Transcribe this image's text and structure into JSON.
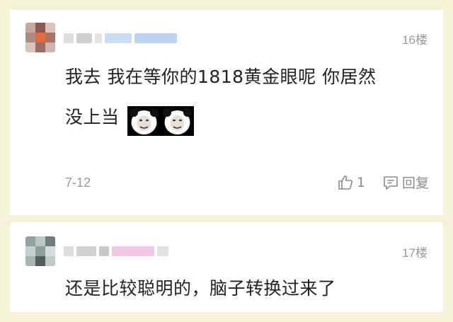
{
  "comments": [
    {
      "floor": "16楼",
      "text_line1": "我去 我在等你的1818黄金眼呢 你居然",
      "text_line2": "没上当",
      "stickers": [
        "panda-meme-sticker",
        "panda-meme-sticker"
      ],
      "date": "7-12",
      "like_count": "1",
      "reply_label": "回复"
    },
    {
      "floor": "17楼",
      "text_line1": "还是比较聪明的，脑子转换过来了"
    }
  ],
  "colors": {
    "page_background": "#f5f2d8",
    "card_background": "#ffffff",
    "meta_gray": "#9a9a9a"
  },
  "icons": [
    "thumbs-up-icon",
    "comment-bubble-icon"
  ]
}
